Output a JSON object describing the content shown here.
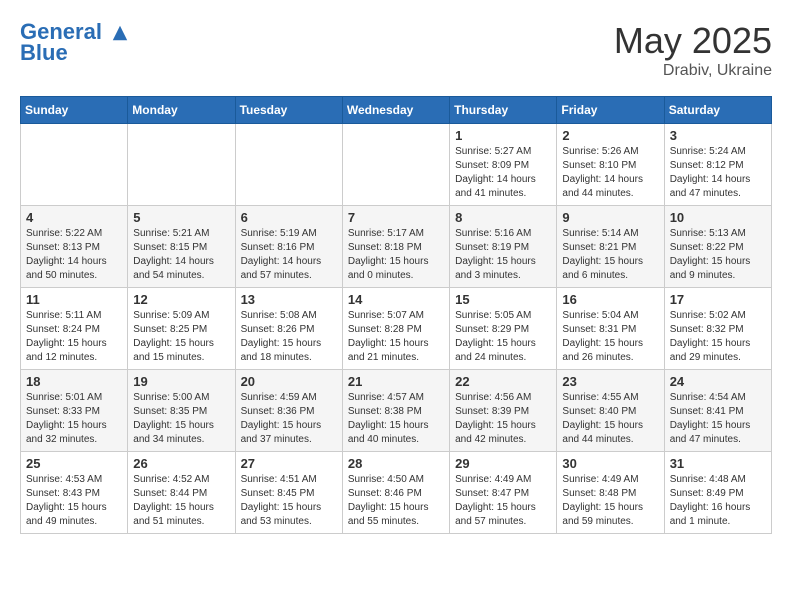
{
  "logo": {
    "line1": "General",
    "line2": "Blue"
  },
  "title": {
    "month_year": "May 2025",
    "location": "Drabiv, Ukraine"
  },
  "weekdays": [
    "Sunday",
    "Monday",
    "Tuesday",
    "Wednesday",
    "Thursday",
    "Friday",
    "Saturday"
  ],
  "weeks": [
    [
      {
        "day": "",
        "info": ""
      },
      {
        "day": "",
        "info": ""
      },
      {
        "day": "",
        "info": ""
      },
      {
        "day": "",
        "info": ""
      },
      {
        "day": "1",
        "info": "Sunrise: 5:27 AM\nSunset: 8:09 PM\nDaylight: 14 hours\nand 41 minutes."
      },
      {
        "day": "2",
        "info": "Sunrise: 5:26 AM\nSunset: 8:10 PM\nDaylight: 14 hours\nand 44 minutes."
      },
      {
        "day": "3",
        "info": "Sunrise: 5:24 AM\nSunset: 8:12 PM\nDaylight: 14 hours\nand 47 minutes."
      }
    ],
    [
      {
        "day": "4",
        "info": "Sunrise: 5:22 AM\nSunset: 8:13 PM\nDaylight: 14 hours\nand 50 minutes."
      },
      {
        "day": "5",
        "info": "Sunrise: 5:21 AM\nSunset: 8:15 PM\nDaylight: 14 hours\nand 54 minutes."
      },
      {
        "day": "6",
        "info": "Sunrise: 5:19 AM\nSunset: 8:16 PM\nDaylight: 14 hours\nand 57 minutes."
      },
      {
        "day": "7",
        "info": "Sunrise: 5:17 AM\nSunset: 8:18 PM\nDaylight: 15 hours\nand 0 minutes."
      },
      {
        "day": "8",
        "info": "Sunrise: 5:16 AM\nSunset: 8:19 PM\nDaylight: 15 hours\nand 3 minutes."
      },
      {
        "day": "9",
        "info": "Sunrise: 5:14 AM\nSunset: 8:21 PM\nDaylight: 15 hours\nand 6 minutes."
      },
      {
        "day": "10",
        "info": "Sunrise: 5:13 AM\nSunset: 8:22 PM\nDaylight: 15 hours\nand 9 minutes."
      }
    ],
    [
      {
        "day": "11",
        "info": "Sunrise: 5:11 AM\nSunset: 8:24 PM\nDaylight: 15 hours\nand 12 minutes."
      },
      {
        "day": "12",
        "info": "Sunrise: 5:09 AM\nSunset: 8:25 PM\nDaylight: 15 hours\nand 15 minutes."
      },
      {
        "day": "13",
        "info": "Sunrise: 5:08 AM\nSunset: 8:26 PM\nDaylight: 15 hours\nand 18 minutes."
      },
      {
        "day": "14",
        "info": "Sunrise: 5:07 AM\nSunset: 8:28 PM\nDaylight: 15 hours\nand 21 minutes."
      },
      {
        "day": "15",
        "info": "Sunrise: 5:05 AM\nSunset: 8:29 PM\nDaylight: 15 hours\nand 24 minutes."
      },
      {
        "day": "16",
        "info": "Sunrise: 5:04 AM\nSunset: 8:31 PM\nDaylight: 15 hours\nand 26 minutes."
      },
      {
        "day": "17",
        "info": "Sunrise: 5:02 AM\nSunset: 8:32 PM\nDaylight: 15 hours\nand 29 minutes."
      }
    ],
    [
      {
        "day": "18",
        "info": "Sunrise: 5:01 AM\nSunset: 8:33 PM\nDaylight: 15 hours\nand 32 minutes."
      },
      {
        "day": "19",
        "info": "Sunrise: 5:00 AM\nSunset: 8:35 PM\nDaylight: 15 hours\nand 34 minutes."
      },
      {
        "day": "20",
        "info": "Sunrise: 4:59 AM\nSunset: 8:36 PM\nDaylight: 15 hours\nand 37 minutes."
      },
      {
        "day": "21",
        "info": "Sunrise: 4:57 AM\nSunset: 8:38 PM\nDaylight: 15 hours\nand 40 minutes."
      },
      {
        "day": "22",
        "info": "Sunrise: 4:56 AM\nSunset: 8:39 PM\nDaylight: 15 hours\nand 42 minutes."
      },
      {
        "day": "23",
        "info": "Sunrise: 4:55 AM\nSunset: 8:40 PM\nDaylight: 15 hours\nand 44 minutes."
      },
      {
        "day": "24",
        "info": "Sunrise: 4:54 AM\nSunset: 8:41 PM\nDaylight: 15 hours\nand 47 minutes."
      }
    ],
    [
      {
        "day": "25",
        "info": "Sunrise: 4:53 AM\nSunset: 8:43 PM\nDaylight: 15 hours\nand 49 minutes."
      },
      {
        "day": "26",
        "info": "Sunrise: 4:52 AM\nSunset: 8:44 PM\nDaylight: 15 hours\nand 51 minutes."
      },
      {
        "day": "27",
        "info": "Sunrise: 4:51 AM\nSunset: 8:45 PM\nDaylight: 15 hours\nand 53 minutes."
      },
      {
        "day": "28",
        "info": "Sunrise: 4:50 AM\nSunset: 8:46 PM\nDaylight: 15 hours\nand 55 minutes."
      },
      {
        "day": "29",
        "info": "Sunrise: 4:49 AM\nSunset: 8:47 PM\nDaylight: 15 hours\nand 57 minutes."
      },
      {
        "day": "30",
        "info": "Sunrise: 4:49 AM\nSunset: 8:48 PM\nDaylight: 15 hours\nand 59 minutes."
      },
      {
        "day": "31",
        "info": "Sunrise: 4:48 AM\nSunset: 8:49 PM\nDaylight: 16 hours\nand 1 minute."
      }
    ]
  ]
}
